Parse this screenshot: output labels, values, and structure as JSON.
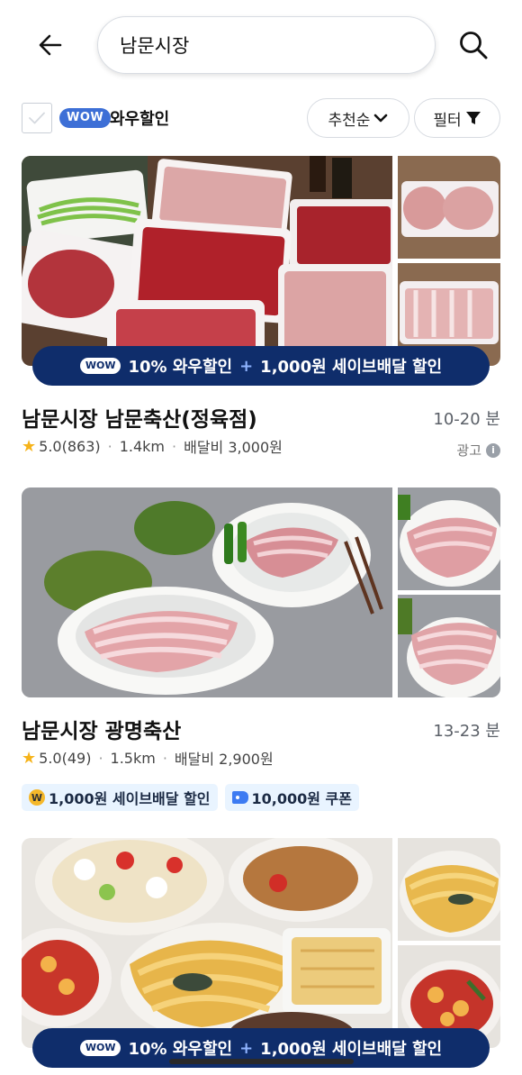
{
  "search": {
    "query": "남문시장"
  },
  "icons": {
    "back": "arrow-left-icon",
    "search": "magnifier-icon",
    "sort": "chevron-down-icon",
    "filter": "funnel-icon",
    "checkbox": "checkmark-icon",
    "rating": "star-icon",
    "info": "info-icon",
    "coin": "coin-icon",
    "coupon": "tag-icon"
  },
  "filters": {
    "wow_badge": "WOW",
    "wow_label": "와우할인",
    "sort_label": "추천순",
    "filter_label": "필터"
  },
  "colors": {
    "brand_blue": "#3d6fd6",
    "promo_bar": "#0f2d6b",
    "coupon_bg": "#e9f4ff",
    "star": "#f6b31a"
  },
  "stores": [
    {
      "promo": {
        "wow": "WOW",
        "left": "10% 와우할인",
        "plus": "+",
        "right": "1,000원 세이브배달 할인"
      },
      "name": "남문시장 남문축산(정육점)",
      "eta": "10-20 분",
      "star": "★",
      "rating": "5.0(863)",
      "distance": "1.4km",
      "delivery_fee": "배달비 3,000원",
      "ad_label": "광고",
      "info_symbol": "i"
    },
    {
      "name": "남문시장 광명축산",
      "eta": "13-23 분",
      "star": "★",
      "rating": "5.0(49)",
      "distance": "1.5km",
      "delivery_fee": "배달비 2,900원",
      "coupons": [
        {
          "coin_symbol": "W",
          "label": "1,000원 세이브배달 할인"
        },
        {
          "label": "10,000원 쿠폰"
        }
      ]
    },
    {
      "promo": {
        "wow": "WOW",
        "left": "10% 와우할인",
        "plus": "+",
        "right": "1,000원 세이브배달 할인"
      }
    }
  ]
}
